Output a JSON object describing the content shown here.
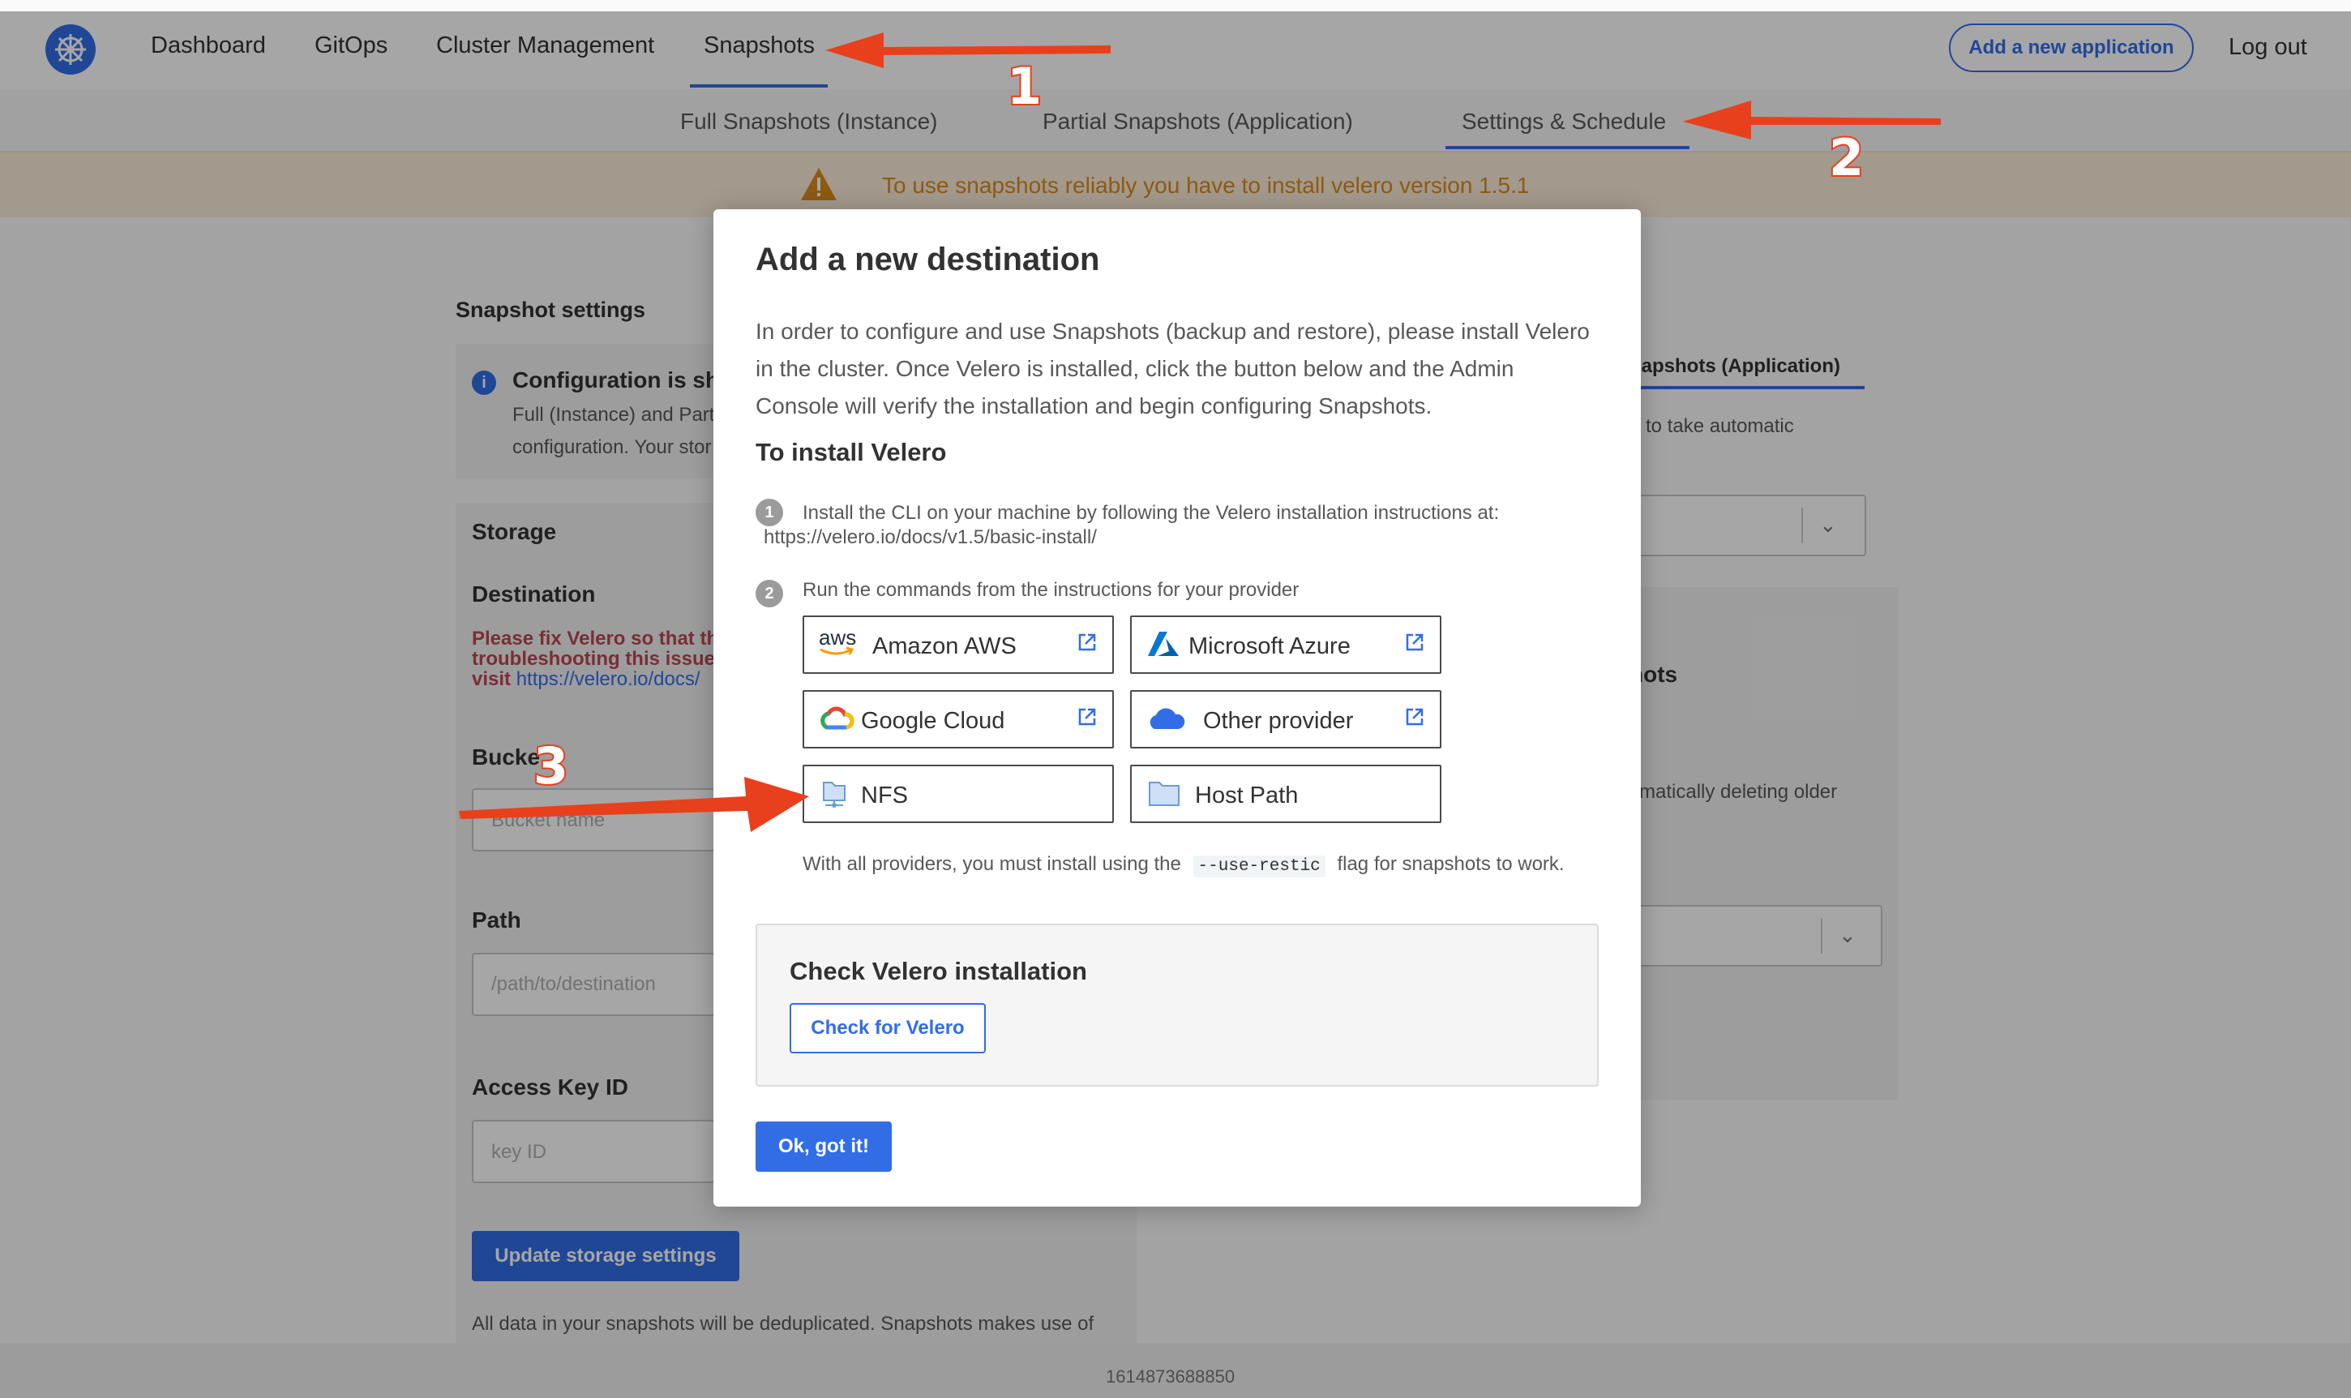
{
  "nav": {
    "items": [
      "Dashboard",
      "GitOps",
      "Cluster Management",
      "Snapshots"
    ],
    "add_app": "Add a new application",
    "logout": "Log out"
  },
  "subnav": {
    "items": [
      "Full Snapshots (Instance)",
      "Partial Snapshots (Application)",
      "Settings & Schedule"
    ]
  },
  "banner": {
    "text": "To use snapshots reliably you have to install velero version 1.5.1"
  },
  "background": {
    "snapshot_settings": "Snapshot settings",
    "config_title": "Configuration is sh",
    "config_line1": "Full (Instance) and Part",
    "config_line2": "configuration. Your stor",
    "storage": "Storage",
    "destination": "Destination",
    "err_line1": "Please fix Velero so that th",
    "err_line2": "troubleshooting this issue",
    "err_line3_prefix": "visit",
    "err_link": "https://velero.io/docs/",
    "bucket_label": "Bucke",
    "bucket_placeholder": "Bucket name",
    "path_label": "Path",
    "path_placeholder": "/path/to/destination",
    "access_key_label": "Access Key ID",
    "access_key_placeholder": "key ID",
    "update_btn": "Update storage settings",
    "dedup_text": "All data in your snapshots will be deduplicated. Snapshots makes use of",
    "right_tab": "napshots (Application)",
    "right_text1": "to take automatic",
    "right_heading": "hots",
    "right_text2": "matically deleting older"
  },
  "modal": {
    "title": "Add a new destination",
    "description": "In order to configure and use Snapshots (backup and restore), please install Velero in the cluster. Once Velero is installed, click the button below and the Admin Console will verify the installation and begin configuring Snapshots.",
    "subtitle": "To install Velero",
    "step1_num": "1",
    "step1_text": "Install the CLI on your machine by following the Velero installation instructions at:",
    "step1_link": "https://velero.io/docs/v1.5/basic-install/",
    "step2_num": "2",
    "step2_text": "Run the commands from the instructions for your provider",
    "providers": [
      {
        "label": "Amazon AWS",
        "icon": "aws-icon"
      },
      {
        "label": "Microsoft Azure",
        "icon": "azure-icon"
      },
      {
        "label": "Google Cloud",
        "icon": "google-cloud-icon"
      },
      {
        "label": "Other provider",
        "icon": "cloud-icon"
      },
      {
        "label": "NFS",
        "icon": "nfs-folder-icon"
      },
      {
        "label": "Host Path",
        "icon": "folder-icon"
      }
    ],
    "aws_logo_text": "aws",
    "note_prefix": "With all providers, you must install using the",
    "note_code": "--use-restic",
    "note_suffix": "flag for snapshots to work.",
    "check_title": "Check Velero installation",
    "check_btn": "Check for Velero",
    "ok_btn": "Ok, got it!"
  },
  "footer": {
    "text": "1614873688850"
  },
  "annotations": [
    "1",
    "2",
    "3"
  ],
  "colors": {
    "accent": "#326de6",
    "warning": "#d98a1d",
    "error": "#bc4752",
    "annotation": "#e8401c"
  }
}
